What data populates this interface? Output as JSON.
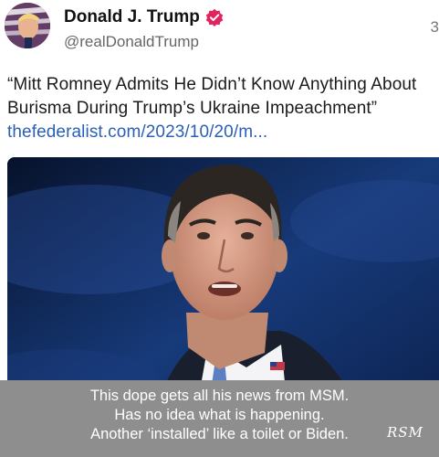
{
  "post": {
    "display_name": "Donald J. Trump",
    "handle": "@realDonaldTrump",
    "timestamp": "3",
    "text": "“Mitt Romney Admits He Didn’t Know Anything About Burisma During Trump’s Ukraine Impeachment”",
    "link": "thefederalist.com/2023/10/20/m..."
  },
  "caption": {
    "lines": [
      "This dope gets all his news from MSM.",
      "Has no idea what is happening.",
      "Another ‘installed’ like a toilet or Biden."
    ],
    "signature": "RSM"
  },
  "colors": {
    "link": "#2b5fb5",
    "verified_badge": "#e0245e",
    "caption_bg": "#8e8e8e"
  },
  "icons": {
    "verified": "verified-badge-icon",
    "avatar": "avatar"
  }
}
